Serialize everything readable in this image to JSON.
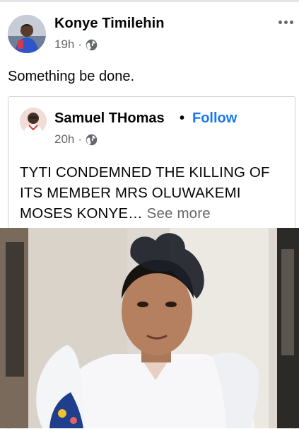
{
  "post": {
    "author": "Konye Timilehin",
    "time": "19h",
    "separator": "·",
    "privacy_icon": "globe-icon",
    "more_icon": "more-options-icon",
    "text": "Something be done."
  },
  "shared_post": {
    "author": "Samuel THomas",
    "separator": "•",
    "follow_label": "Follow",
    "time": "20h",
    "time_separator": "·",
    "privacy_icon": "globe-icon",
    "text": "TYTI CONDEMNED THE KILLING OF ITS MEMBER MRS OLUWAKEMI MOSES KONYE…",
    "see_more_label": "See more"
  },
  "colors": {
    "link": "#1877f2",
    "secondary_text": "#65676b",
    "border": "#ced0d4"
  }
}
